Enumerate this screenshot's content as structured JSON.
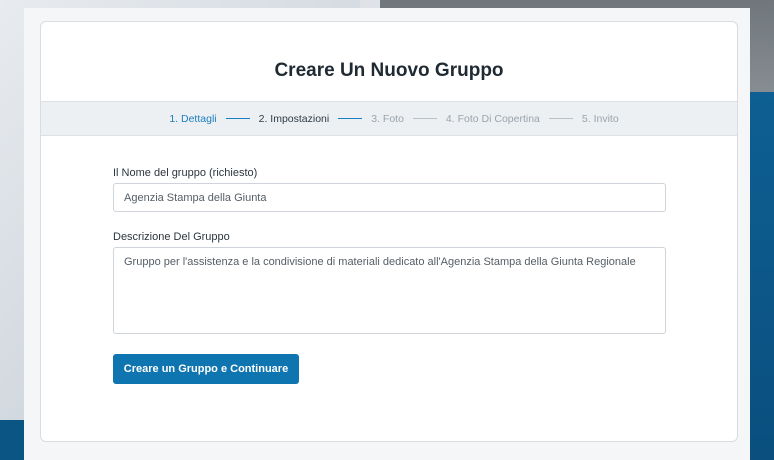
{
  "page": {
    "title": "Creare Un Nuovo Gruppo"
  },
  "steps": [
    {
      "label": "1. Dettagli",
      "state": "done"
    },
    {
      "label": "2. Impostazioni",
      "state": "current"
    },
    {
      "label": "3. Foto",
      "state": "todo"
    },
    {
      "label": "4. Foto Di Copertina",
      "state": "todo"
    },
    {
      "label": "5. Invito",
      "state": "todo"
    }
  ],
  "form": {
    "name_label": "Il Nome del gruppo (richiesto)",
    "name_value": "Agenzia Stampa della Giunta",
    "description_label": "Descrizione Del Gruppo",
    "description_value": "Gruppo per l'assistenza e la condivisione di materiali dedicato all'Agenzia Stampa della Giunta Regionale",
    "submit_label": "Creare un Gruppo e Continuare"
  },
  "colors": {
    "accent": "#0e75b0",
    "step_active": "#1a7fc0",
    "step_todo": "#9aa3ab"
  }
}
